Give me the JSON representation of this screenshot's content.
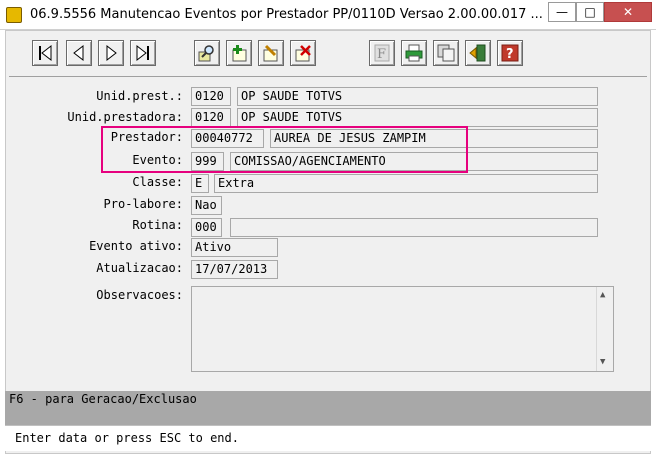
{
  "window": {
    "title": "06.9.5556 Manutencao  Eventos por Prestador  PP/0110D Versao 2.00.00.017 ...",
    "minimize": "—",
    "maximize": "□",
    "close": "✕"
  },
  "toolbar": {
    "first_icon": "first-record-icon",
    "prev_icon": "previous-record-icon",
    "next_icon": "next-record-icon",
    "last_icon": "last-record-icon",
    "search_icon": "search-icon",
    "add_icon": "add-icon",
    "edit_icon": "edit-icon",
    "delete_icon": "delete-icon",
    "filter_icon": "filter-icon",
    "print_icon": "print-icon",
    "copy_icon": "copy-icon",
    "exit_icon": "exit-icon",
    "help_icon": "help-icon",
    "help_label": "?",
    "filter_label": "F"
  },
  "form": {
    "unid_prest": {
      "label": "Unid.prest.:",
      "code": "0120",
      "name": "OP SAUDE TOTVS"
    },
    "unid_prestadora": {
      "label": "Unid.prestadora:",
      "code": "0120",
      "name": "OP SAUDE TOTVS"
    },
    "prestador": {
      "label": "Prestador:",
      "code": "00040772",
      "name": "AUREA DE JESUS ZAMPIM"
    },
    "evento": {
      "label": "Evento:",
      "code": "999",
      "name": "COMISSAO/AGENCIAMENTO"
    },
    "classe": {
      "label": "Classe:",
      "code": "E",
      "name": "Extra"
    },
    "pro_labore": {
      "label": "Pro-labore:",
      "value": "Nao"
    },
    "rotina": {
      "label": "Rotina:",
      "code": "000",
      "name": ""
    },
    "evento_ativo": {
      "label": "Evento ativo:",
      "value": "Ativo"
    },
    "atualizacao": {
      "label": "Atualizacao:",
      "value": "17/07/2013"
    },
    "observacoes": {
      "label": "Observacoes:",
      "value": ""
    }
  },
  "message": "F6 - para Geracao/Exclusao",
  "status": "Enter data or press ESC to end.",
  "colors": {
    "highlight": "#e6007e",
    "message_bar": "#a8a8a8"
  }
}
